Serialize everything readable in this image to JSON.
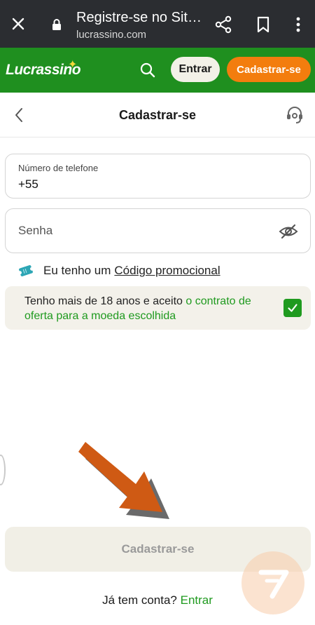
{
  "browser": {
    "title": "Registre-se no Sit…",
    "url": "lucrassino.com"
  },
  "header": {
    "logo": "Lucrassino",
    "login_label": "Entrar",
    "register_label": "Cadastrar-se"
  },
  "page": {
    "title": "Cadastrar-se"
  },
  "form": {
    "phone_label": "Número de telefone",
    "phone_value": "+55",
    "password_placeholder": "Senha",
    "promo_text": "Eu tenho um",
    "promo_link": "Código promocional",
    "agree_text": "Tenho mais de 18 anos e aceito",
    "agree_link": "o contrato de oferta para a moeda escolhida",
    "agree_checked": true,
    "submit_label": "Cadastrar-se",
    "account_text": "Já tem conta?",
    "account_link": "Entrar"
  },
  "colors": {
    "brand_green": "#1f8f1f",
    "accent_orange": "#f37d0e",
    "link_green": "#1f9a1f"
  }
}
